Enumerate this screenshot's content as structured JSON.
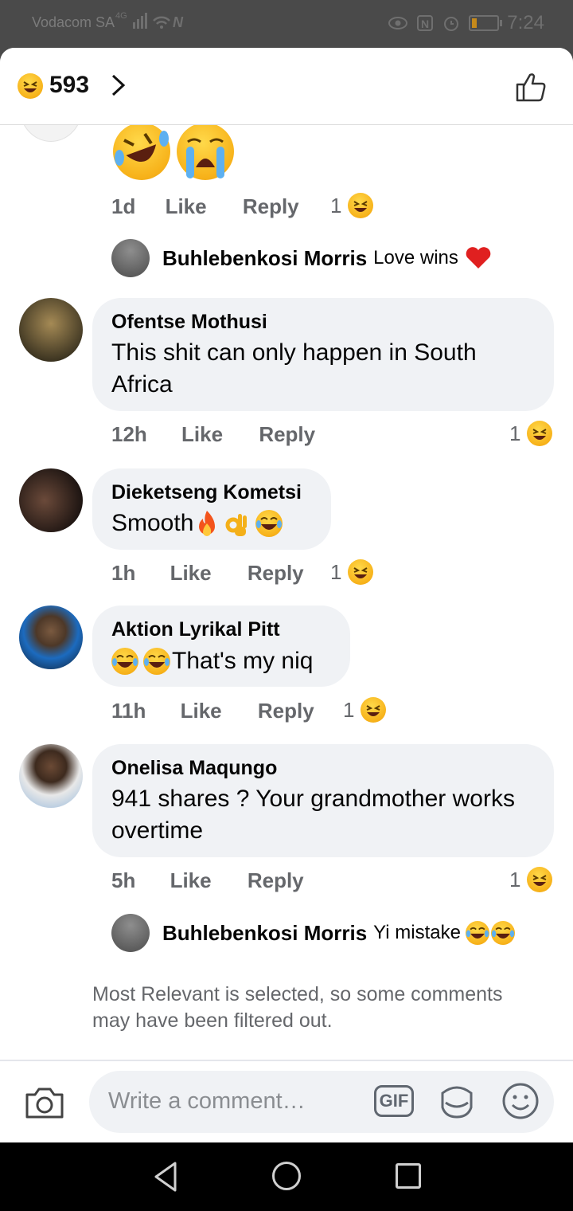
{
  "status_bar": {
    "carrier": "Vodacom SA",
    "network": "4G",
    "time": "7:24",
    "battery_level": 0.22,
    "battery_color": "#c68a1b"
  },
  "reactions_header": {
    "emoji_icon": "laughing-face-icon",
    "count": "593"
  },
  "top_reply": {
    "time": "1d",
    "like_label": "Like",
    "reply_label": "Reply",
    "reaction_count": "1",
    "nested_reply": {
      "name": "Buhlebenkosi Morris",
      "text": "Love wins"
    }
  },
  "comments": [
    {
      "name": "Ofentse Mothusi",
      "text": "This shit can only happen in South Africa",
      "time": "12h",
      "like_label": "Like",
      "reply_label": "Reply",
      "reaction_count": "1"
    },
    {
      "name": "Dieketseng Kometsi",
      "text": "Smooth",
      "time": "1h",
      "like_label": "Like",
      "reply_label": "Reply",
      "reaction_count": "1"
    },
    {
      "name": "Aktion Lyrikal Pitt",
      "text": "That's my niq",
      "time": "11h",
      "like_label": "Like",
      "reply_label": "Reply",
      "reaction_count": "1"
    },
    {
      "name": "Onelisa Maqungo",
      "text": "941 shares ? Your grandmother works overtime",
      "time": "5h",
      "like_label": "Like",
      "reply_label": "Reply",
      "reaction_count": "1",
      "nested_reply": {
        "name": "Buhlebenkosi Morris",
        "text": "Yi mistake"
      }
    }
  ],
  "filter_note": "Most Relevant is selected, so some comments may have been filtered out.",
  "composer": {
    "placeholder": "Write a comment…",
    "gif_label": "GIF"
  }
}
